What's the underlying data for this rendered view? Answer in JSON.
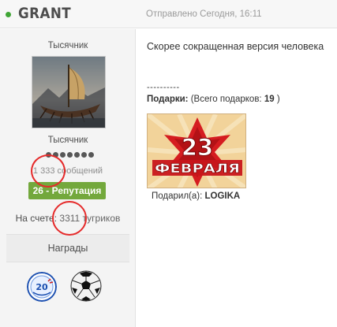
{
  "header": {
    "username": "GRANT",
    "posted": "Отправлено Сегодня, 16:11"
  },
  "profile": {
    "rank_title": "Тысячник",
    "rank_label": "Тысячник",
    "pips_count": 7,
    "post_count": "1 333 сообщений",
    "reputation": "26 - Репутация",
    "balance_label": "На счете:",
    "balance_value": "3311",
    "balance_currency": "тугриков",
    "awards_tab": "Награды",
    "awards": [
      {
        "icon": "award-badge-icon"
      },
      {
        "icon": "soccer-ball-icon"
      }
    ]
  },
  "post": {
    "text": "Скорее сокращенная версия человека",
    "separator": "----------",
    "gifts_label": "Подарки:",
    "gifts_summary": "(Всего подарков:",
    "gifts_count": "19",
    "gifts_close": ")",
    "gift_card": {
      "number": "23",
      "month": "ФЕВРАЛЯ"
    },
    "gift_from_label": "Подарил(а):",
    "gift_from_name": "LOGIKA"
  },
  "colors": {
    "online": "#3fa535",
    "reputation": "#73a83c",
    "annotation": "#e52a2a"
  }
}
